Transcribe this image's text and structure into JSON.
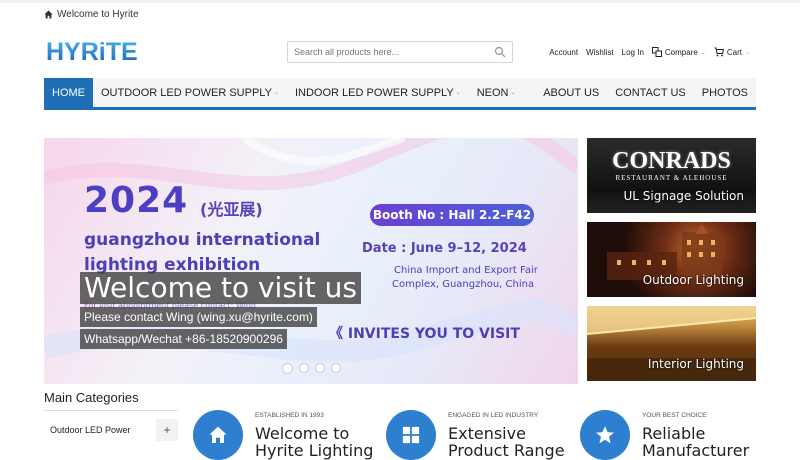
{
  "header": {
    "welcome": "Welcome to Hyrite",
    "logo_text": "HYRiTE",
    "search_placeholder": "Search all products here...",
    "links": {
      "account": "Account",
      "wishlist": "Wishlist",
      "login": "Log In",
      "compare": "Compare",
      "cart": "Cart"
    }
  },
  "nav": {
    "items": [
      {
        "label": "HOME",
        "dropdown": false
      },
      {
        "label": "OUTDOOR LED POWER SUPPLY",
        "dropdown": true
      },
      {
        "label": "INDOOR LED POWER SUPPLY",
        "dropdown": true
      },
      {
        "label": "NEON",
        "dropdown": true
      }
    ],
    "right_items": [
      "ABOUT US",
      "CONTACT US",
      "PHOTOS"
    ]
  },
  "slider": {
    "year": "2024",
    "cn": "(光亚展)",
    "title_line1": "guangzhou international",
    "title_line2": "lighting exhibition",
    "booth": "Booth No : Hall 2.2–F42",
    "date": "Date : June 9–12, 2024",
    "fair_line1": "China Import and Export Fair",
    "fair_line2": "Complex, Guangzhou, China",
    "visit_note": "For visit appointment please contact: Wing",
    "invites": "《  INVITES YOU TO VISIT",
    "caption_head": "Welcome to visit us",
    "caption_line1": "Please contact Wing (wing.xu@hyrite.com)",
    "caption_line2": "Whatsapp/Wechat +86-18520900296",
    "dots": 4,
    "active_dot": 0
  },
  "side_banners": {
    "card1_sign": "CONRADS",
    "card1_sub": "RESTAURANT & ALEHOUSE",
    "card1_label": "UL Signage Solution",
    "card2_label": "Outdoor Lighting",
    "card3_label": "Interior Lighting"
  },
  "categories": {
    "title": "Main Categories",
    "items": [
      {
        "label": "Outdoor LED Power"
      }
    ]
  },
  "features": [
    {
      "small": "ESTABLISHED IN 1993",
      "line1": "Welcome to",
      "line2": "Hyrite Lighting",
      "icon": "home-icon"
    },
    {
      "small": "ENGAGED IN LED INDUSTRY",
      "line1": "Extensive",
      "line2": "Product Range",
      "icon": "grid-icon"
    },
    {
      "small": "YOUR BEST CHOICE",
      "line1": "Reliable",
      "line2": "Manufacturer",
      "icon": "star-icon"
    }
  ],
  "colors": {
    "brand_blue": "#1f6fb5",
    "feature_blue": "#2f7fd1"
  }
}
